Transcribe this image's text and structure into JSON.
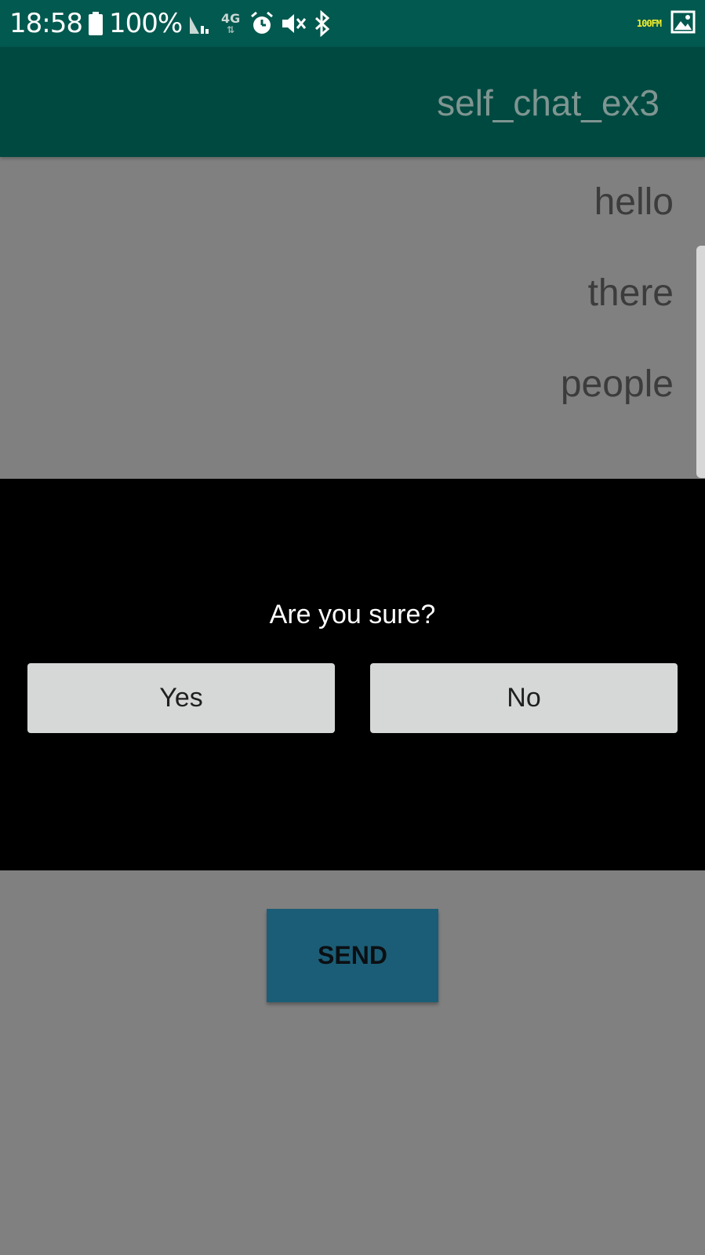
{
  "status_bar": {
    "time": "18:58",
    "battery": "100%",
    "network": "4G",
    "fm_badge": "100FM",
    "icons": [
      "battery-icon",
      "signal-icon",
      "network-icon",
      "alarm-icon",
      "mute-icon",
      "bluetooth-icon",
      "image-icon"
    ]
  },
  "app_bar": {
    "title": "self_chat_ex3"
  },
  "messages": [
    {
      "text": "hello"
    },
    {
      "text": "there"
    },
    {
      "text": "people"
    }
  ],
  "dialog": {
    "message": "Are you sure?",
    "yes_label": "Yes",
    "no_label": "No"
  },
  "send_button": {
    "label": "SEND"
  },
  "colors": {
    "status_bar_bg": "#02594f",
    "app_bar_bg": "#004940",
    "scrim_bg": "#808080",
    "dialog_bg": "#000000",
    "dialog_button_bg": "#d6d7d7",
    "send_button_bg": "#1b5d76"
  }
}
